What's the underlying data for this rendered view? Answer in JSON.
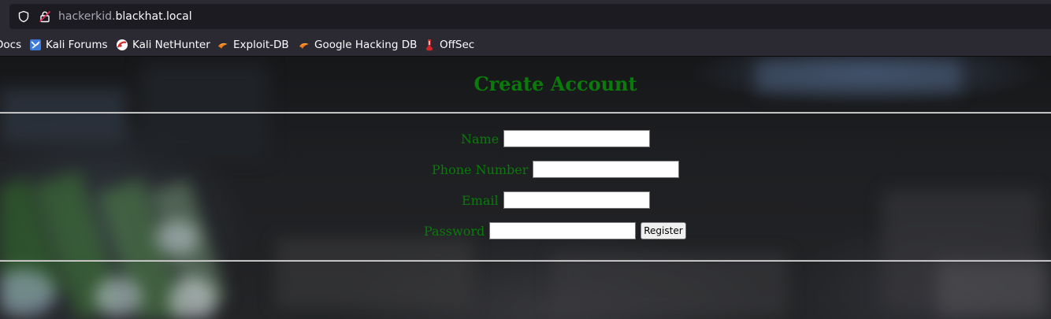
{
  "browser": {
    "url": {
      "subdomain": "hackerkid.",
      "domain": "blackhat.local"
    },
    "bookmarks": [
      {
        "label": "Docs",
        "icon": "docs-icon"
      },
      {
        "label": "Kali Forums",
        "icon": "kali-forums-icon"
      },
      {
        "label": "Kali NetHunter",
        "icon": "kali-nethunter-icon"
      },
      {
        "label": "Exploit-DB",
        "icon": "exploit-db-icon"
      },
      {
        "label": "Google Hacking DB",
        "icon": "google-hacking-db-icon"
      },
      {
        "label": "OffSec",
        "icon": "offsec-icon"
      }
    ]
  },
  "page": {
    "title": "Create Account",
    "form": {
      "name_label": "Name",
      "name_value": "",
      "phone_label": "Phone Number",
      "phone_value": "",
      "email_label": "Email",
      "email_value": "",
      "password_label": "Password",
      "password_value": "",
      "register_label": "Register"
    }
  },
  "colors": {
    "heading_green": "#0a7a0a",
    "browser_toolbar": "#2b2a33",
    "urlbar_bg": "#1c1b22"
  }
}
